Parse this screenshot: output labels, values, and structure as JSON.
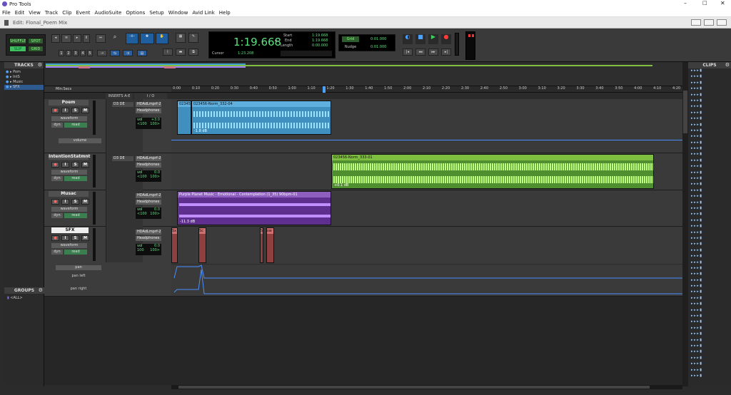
{
  "app": {
    "title": "Pro Tools",
    "window_title": "Edit: Flonal_Poem Mix"
  },
  "menu": [
    "File",
    "Edit",
    "View",
    "Track",
    "Clip",
    "Event",
    "AudioSuite",
    "Options",
    "Setup",
    "Window",
    "Avid Link",
    "Help"
  ],
  "modes": {
    "shuffle": "SHUFFLE",
    "spot": "SPOT",
    "slip": "SLIP",
    "grid": "GRID"
  },
  "numbers": [
    "1",
    "2",
    "3",
    "4",
    "5"
  ],
  "counter": {
    "main": "1:19.668",
    "start_label": "Start",
    "end_label": "End",
    "length_label": "Length",
    "start": "1:19.668",
    "end": "1:19.668",
    "length": "0:00.000",
    "cursor_label": "Cursor",
    "cursor": "1:23.208"
  },
  "grid": {
    "label": "Grid",
    "value": "0:01.000",
    "nudge_label": "Nudge",
    "nudge": "0:01.000"
  },
  "tracks_pane": {
    "title": "TRACKS",
    "items": [
      "Pom",
      "IntS",
      "Music",
      "SFX"
    ]
  },
  "groups_pane": {
    "title": "GROUPS",
    "item": "<ALL>"
  },
  "clips_pane": {
    "title": "CLIPS"
  },
  "timeline": {
    "label": "Min:Secs",
    "ticks": [
      "0:00",
      "0:10",
      "0:20",
      "0:30",
      "0:40",
      "0:50",
      "1:00",
      "1:10",
      "1:20",
      "1:30",
      "1:40",
      "1:50",
      "2:00",
      "2:10",
      "2:20",
      "2:30",
      "2:40",
      "2:50",
      "3:00",
      "3:10",
      "3:20",
      "3:30",
      "3:40",
      "3:50",
      "4:00",
      "4:10",
      "4:20"
    ]
  },
  "col_headers": {
    "inserts": "INSERTS A-E",
    "io": "I / O"
  },
  "tracks": [
    {
      "name": "Poem",
      "insert": "D3 DE",
      "io_in": "HDAdLmprf-2",
      "io_out": "Headphones",
      "vol_label": "vol",
      "vol": "+3.0",
      "pan_l": "<100",
      "pan_r": "100>",
      "view": "waveform",
      "dyn": "dyn",
      "read": "read",
      "auto": "volume",
      "clips": [
        {
          "name": "023456",
          "level": ""
        },
        {
          "name": "023456-Norm_332-04",
          "level": "-1.8 dB"
        }
      ]
    },
    {
      "name": "IntentionStatmnt",
      "insert": "D3 DE",
      "io_in": "HDAdLmprf-2",
      "io_out": "Headphones",
      "vol_label": "vol",
      "vol": "0.0",
      "pan_l": "<100",
      "pan_r": "100>",
      "view": "waveform",
      "dyn": "dyn",
      "read": "read",
      "clips": [
        {
          "name": "023456-Norm_333-01",
          "level": "+0.1 dB"
        }
      ]
    },
    {
      "name": "Musac",
      "io_in": "HDAdLmprf-2",
      "io_out": "Headphones",
      "vol_label": "vol",
      "vol": "0.0",
      "pan_l": "<100",
      "pan_r": "100>",
      "view": "waveform",
      "dyn": "dyn",
      "read": "read",
      "clips": [
        {
          "name": "Purple Planet Music - Emotional - Contemplation (1_35) 90bpm-01",
          "level": "-11.3 dB"
        }
      ]
    },
    {
      "name": "SFX",
      "io_in": "HDAdLmprf-2",
      "io_out": "Headphones",
      "vol_label": "vol",
      "vol": "0.0",
      "pan_l": "100",
      "pan_r": "100>",
      "view": "waveform",
      "dyn": "dyn",
      "read": "read",
      "auto": "pan",
      "lanes": [
        "pan left",
        "pan right"
      ],
      "clips": [
        {
          "name": "Sx"
        },
        {
          "name": "Sc"
        },
        {
          "name": "Sx"
        },
        {
          "name": "sw"
        }
      ]
    }
  ],
  "colors": {
    "poem": "#3f9fcf",
    "intention": "#7fbf3f",
    "music": "#6f3f9f",
    "sfx": "#9f3f3f",
    "counter_green": "#5fe07f"
  }
}
